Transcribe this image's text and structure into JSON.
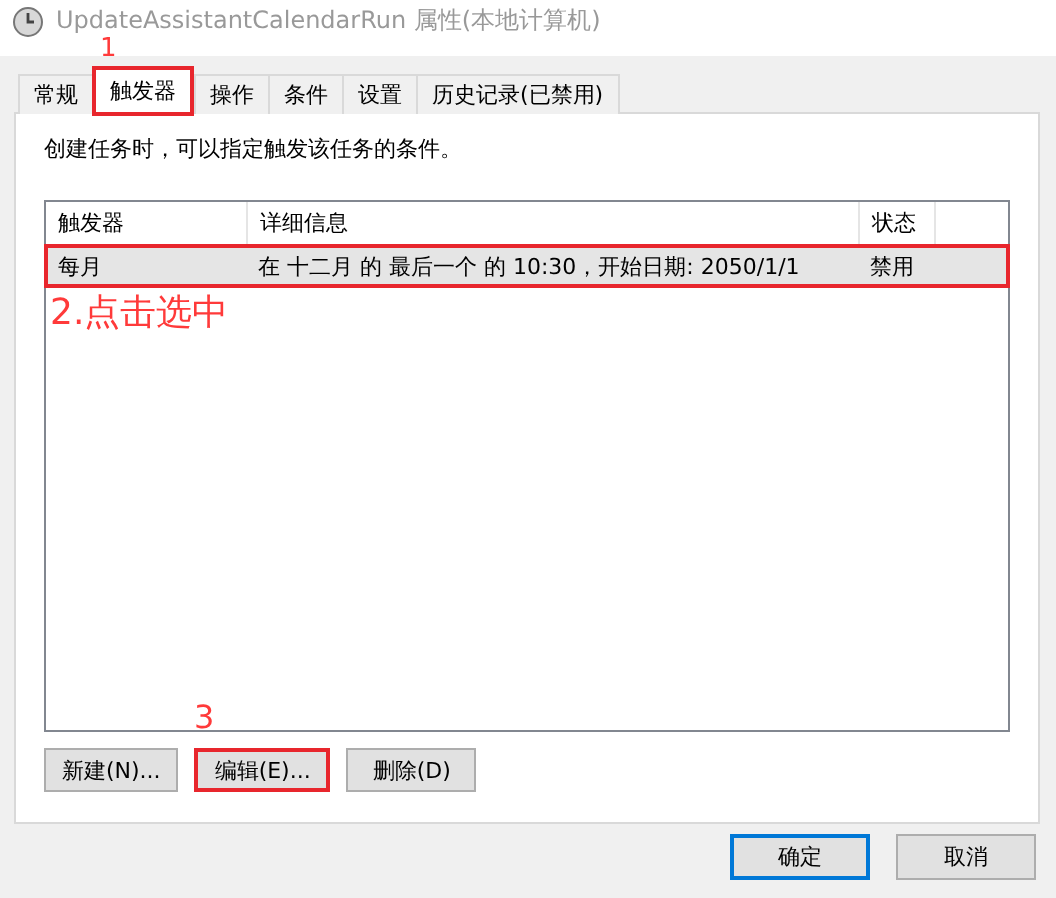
{
  "window": {
    "title": "UpdateAssistantCalendarRun 属性(本地计算机)"
  },
  "tabs": [
    {
      "label": "常规",
      "selected": false,
      "highlighted": false
    },
    {
      "label": "触发器",
      "selected": true,
      "highlighted": true
    },
    {
      "label": "操作",
      "selected": false,
      "highlighted": false
    },
    {
      "label": "条件",
      "selected": false,
      "highlighted": false
    },
    {
      "label": "设置",
      "selected": false,
      "highlighted": false
    },
    {
      "label": "历史记录(已禁用)",
      "selected": false,
      "highlighted": false
    }
  ],
  "description": "创建任务时，可以指定触发该任务的条件。",
  "table": {
    "columns": [
      "触发器",
      "详细信息",
      "状态"
    ],
    "rows": [
      {
        "cells": [
          "每月",
          "在 十二月 的 最后一个 的 10:30，开始日期: 2050/1/1",
          "禁用"
        ],
        "selected": true,
        "highlighted": true
      }
    ]
  },
  "list_buttons": [
    {
      "label": "新建(N)...",
      "highlighted": false
    },
    {
      "label": "编辑(E)...",
      "highlighted": true
    },
    {
      "label": "删除(D)",
      "highlighted": false
    }
  ],
  "dialog_buttons": [
    {
      "label": "确定",
      "default": true
    },
    {
      "label": "取消",
      "default": false
    }
  ],
  "annotations": [
    {
      "kind": "tab-step",
      "text": "1"
    },
    {
      "kind": "row-step",
      "text": "2.点击选中"
    },
    {
      "kind": "button-step",
      "text": "3"
    }
  ]
}
